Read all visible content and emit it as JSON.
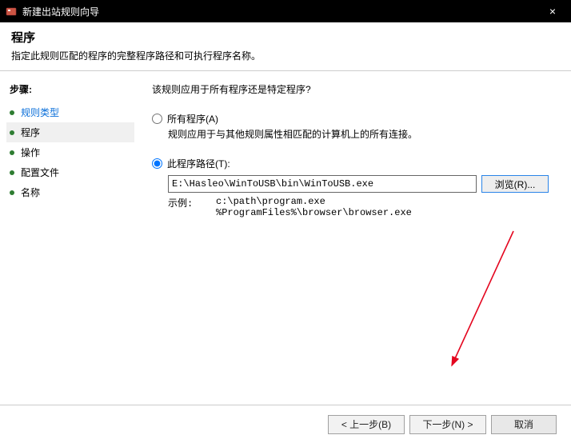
{
  "window": {
    "title": "新建出站规则向导",
    "close": "×"
  },
  "header": {
    "title": "程序",
    "subtitle": "指定此规则匹配的程序的完整程序路径和可执行程序名称。"
  },
  "sidebar": {
    "label": "步骤:",
    "steps": [
      {
        "label": "规则类型",
        "link": true
      },
      {
        "label": "程序",
        "active": true
      },
      {
        "label": "操作"
      },
      {
        "label": "配置文件"
      },
      {
        "label": "名称"
      }
    ]
  },
  "content": {
    "question": "该规则应用于所有程序还是特定程序?",
    "allPrograms": {
      "label": "所有程序(A)",
      "desc": "规则应用于与其他规则属性相匹配的计算机上的所有连接。"
    },
    "thisProgram": {
      "label": "此程序路径(T):",
      "path": "E:\\Hasleo\\WinToUSB\\bin\\WinToUSB.exe",
      "browse": "浏览(R)...",
      "exampleLabel": "示例:",
      "examplePaths": "c:\\path\\program.exe\n%ProgramFiles%\\browser\\browser.exe"
    }
  },
  "footer": {
    "back": "< 上一步(B)",
    "next": "下一步(N) >",
    "cancel": "取消"
  }
}
